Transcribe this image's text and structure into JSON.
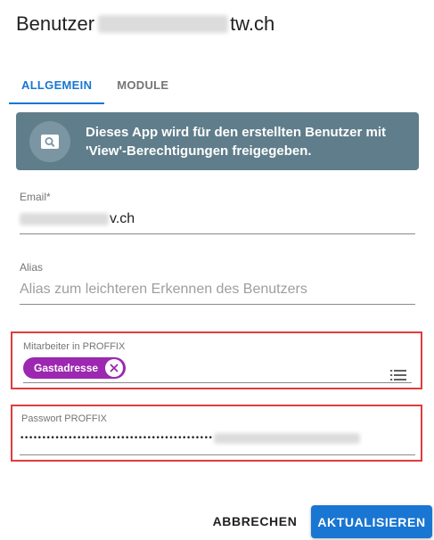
{
  "dialog": {
    "title_prefix": "Benutzer",
    "title_suffix": "tw.ch"
  },
  "tabs": [
    {
      "label": "ALLGEMEIN",
      "active": true
    },
    {
      "label": "MODULE",
      "active": false
    }
  ],
  "info": {
    "icon": "search-icon",
    "line1": "Dieses App wird für den erstellten Benutzer mit",
    "line2": "'View'-Berechtigungen freigegeben."
  },
  "email": {
    "label": "Email*",
    "value_visible_suffix": "v.ch"
  },
  "alias": {
    "label": "Alias",
    "placeholder": "Alias zum leichteren Erkennen des Benutzers"
  },
  "employee": {
    "label": "Mitarbeiter in PROFFIX",
    "chip_label": "Gastadresse",
    "chip_icon": "close-icon",
    "menu_icon": "list-icon"
  },
  "password": {
    "label": "Passwort PROFFIX",
    "masked": "••••••••••••••••••••••••••••••••••••••••••••"
  },
  "actions": {
    "cancel": "ABBRECHEN",
    "submit": "AKTUALISIEREN"
  },
  "colors": {
    "primary": "#1976d2",
    "info_bg": "#5f7d8a",
    "chip": "#9c27b0",
    "highlight": "#e03c3c"
  }
}
